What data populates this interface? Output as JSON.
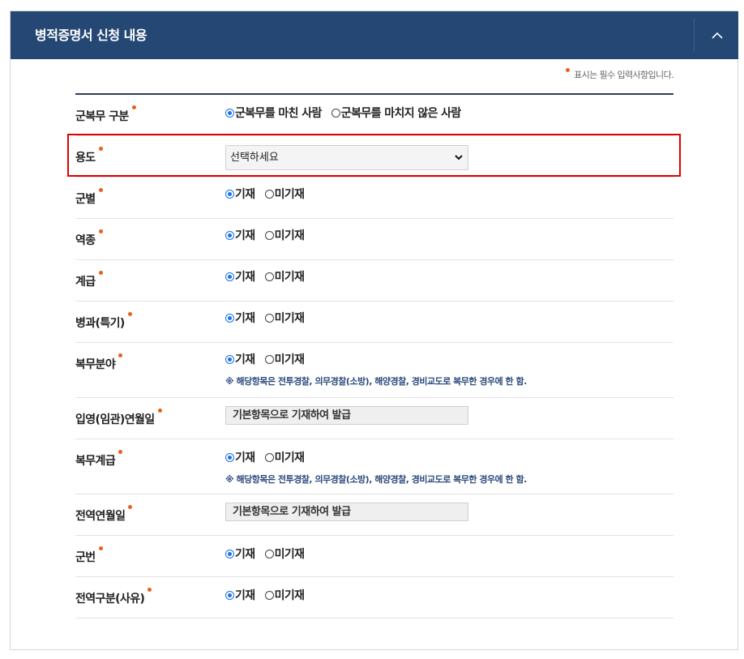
{
  "header": {
    "title": "병적증명서 신청 내용",
    "collapse_icon": "chevron-up-icon"
  },
  "required_note": "표시는 필수 입력사항입니다.",
  "colors": {
    "header_bg": "#254774",
    "required_dot": "#e8601c",
    "radio_checked": "#1a73e8",
    "highlight_border": "#e00000",
    "note_text": "#2c4b7d"
  },
  "rows": {
    "service_type": {
      "label": "군복무 구분",
      "options": [
        "군복무를 마친 사람",
        "군복무를 마치지 않은 사람"
      ],
      "selected": "군복무를 마친 사람"
    },
    "purpose": {
      "label": "용도",
      "select_value": "선택하세요"
    },
    "branch": {
      "label": "군별",
      "options": [
        "기재",
        "미기재"
      ],
      "selected": "기재"
    },
    "role": {
      "label": "역종",
      "options": [
        "기재",
        "미기재"
      ],
      "selected": "기재"
    },
    "rank": {
      "label": "계급",
      "options": [
        "기재",
        "미기재"
      ],
      "selected": "기재"
    },
    "specialty": {
      "label": "병과(특기)",
      "options": [
        "기재",
        "미기재"
      ],
      "selected": "기재"
    },
    "service_field": {
      "label": "복무분야",
      "options": [
        "기재",
        "미기재"
      ],
      "selected": "기재",
      "note": "※ 해당항목은 전투경찰, 의무경찰(소방), 해양경찰, 경비교도로 복무한 경우에 한 함."
    },
    "enlist_date": {
      "label": "입영(임관)연월일",
      "readonly_value": "기본항목으로 기재하여 발급"
    },
    "service_rank": {
      "label": "복무계급",
      "options": [
        "기재",
        "미기재"
      ],
      "selected": "기재",
      "note": "※ 해당항목은 전투경찰, 의무경찰(소방), 해양경찰, 경비교도로 복무한 경우에 한 함."
    },
    "discharge_date": {
      "label": "전역연월일",
      "readonly_value": "기본항목으로 기재하여 발급"
    },
    "service_number": {
      "label": "군번",
      "options": [
        "기재",
        "미기재"
      ],
      "selected": "기재"
    },
    "discharge_type": {
      "label": "전역구분(사유)",
      "options": [
        "기재",
        "미기재"
      ],
      "selected": "기재"
    }
  }
}
